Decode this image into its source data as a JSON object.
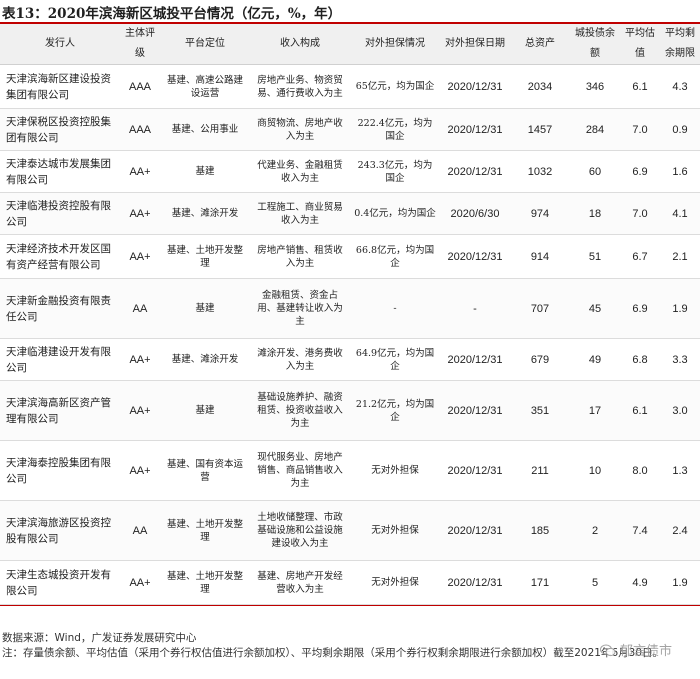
{
  "title": "表13：2020年滨海新区城投平台情况（亿元，%，年）",
  "columns": [
    "发行人",
    "主体评级",
    "平台定位",
    "收入构成",
    "对外担保情况",
    "对外担保日期",
    "总资产",
    "城投债余额",
    "平均估值",
    "平均剩余期限"
  ],
  "rows": [
    {
      "issuer": "天津滨海新区建设投资集团有限公司",
      "rating": "AAA",
      "position": "基建、高速公路建设运营",
      "revenue": "房地产业务、物资贸易、通行费收入为主",
      "guarantee": "65亿元，均为国企",
      "date": "2020/12/31",
      "assets": "2034",
      "bonds": "346",
      "valuation": "6.1",
      "term": "4.3"
    },
    {
      "issuer": "天津保税区投资控股集团有限公司",
      "rating": "AAA",
      "position": "基建、公用事业",
      "revenue": "商贸物流、房地产收入为主",
      "guarantee": "222.4亿元，均为国企",
      "date": "2020/12/31",
      "assets": "1457",
      "bonds": "284",
      "valuation": "7.0",
      "term": "0.9"
    },
    {
      "issuer": "天津泰达城市发展集团有限公司",
      "rating": "AA+",
      "position": "基建",
      "revenue": "代建业务、金融租赁收入为主",
      "guarantee": "243.3亿元，均为国企",
      "date": "2020/12/31",
      "assets": "1032",
      "bonds": "60",
      "valuation": "6.9",
      "term": "1.6"
    },
    {
      "issuer": "天津临港投资控股有限公司",
      "rating": "AA+",
      "position": "基建、滩涂开发",
      "revenue": "工程施工、商业贸易收入为主",
      "guarantee": "0.4亿元，均为国企",
      "date": "2020/6/30",
      "assets": "974",
      "bonds": "18",
      "valuation": "7.0",
      "term": "4.1"
    },
    {
      "issuer": "天津经济技术开发区国有资产经营有限公司",
      "rating": "AA+",
      "position": "基建、土地开发整理",
      "revenue": "房地产销售、租赁收入为主",
      "guarantee": "66.8亿元，均为国企",
      "date": "2020/12/31",
      "assets": "914",
      "bonds": "51",
      "valuation": "6.7",
      "term": "2.1"
    },
    {
      "issuer": "天津新金融投资有限责任公司",
      "rating": "AA",
      "position": "基建",
      "revenue": "金融租赁、资金占用、基建转让收入为主",
      "guarantee": "-",
      "date": "-",
      "assets": "707",
      "bonds": "45",
      "valuation": "6.9",
      "term": "1.9"
    },
    {
      "issuer": "天津临港建设开发有限公司",
      "rating": "AA+",
      "position": "基建、滩涂开发",
      "revenue": "滩涂开发、港务费收入为主",
      "guarantee": "64.9亿元，均为国企",
      "date": "2020/12/31",
      "assets": "679",
      "bonds": "49",
      "valuation": "6.8",
      "term": "3.3"
    },
    {
      "issuer": "天津滨海高新区资产管理有限公司",
      "rating": "AA+",
      "position": "基建",
      "revenue": "基础设施养护、融资租赁、投资收益收入为主",
      "guarantee": "21.2亿元，均为国企",
      "date": "2020/12/31",
      "assets": "351",
      "bonds": "17",
      "valuation": "6.1",
      "term": "3.0"
    },
    {
      "issuer": "天津海泰控股集团有限公司",
      "rating": "AA+",
      "position": "基建、国有资本运营",
      "revenue": "现代服务业、房地产销售、商品销售收入为主",
      "guarantee": "无对外担保",
      "date": "2020/12/31",
      "assets": "211",
      "bonds": "10",
      "valuation": "8.0",
      "term": "1.3"
    },
    {
      "issuer": "天津滨海旅游区投资控股有限公司",
      "rating": "AA",
      "position": "基建、土地开发整理",
      "revenue": "土地收储整理、市政基础设施和公益设施建设收入为主",
      "guarantee": "无对外担保",
      "date": "2020/12/31",
      "assets": "185",
      "bonds": "2",
      "valuation": "7.4",
      "term": "2.4"
    },
    {
      "issuer": "天津生态城投资开发有限公司",
      "rating": "AA+",
      "position": "基建、土地开发整理",
      "revenue": "基建、房地产开发经营收入为主",
      "guarantee": "无对外担保",
      "date": "2020/12/31",
      "assets": "171",
      "bonds": "5",
      "valuation": "4.9",
      "term": "1.9"
    }
  ],
  "source": "数据来源：Wind，广发证券发展研究中心",
  "note": "注：存量债余额、平均估值（采用个券行权估值进行余额加权）、平均剩余期限（采用个券行权剩余期限进行余额加权）截至2021年6月30日。",
  "watermark": "郁言债市"
}
